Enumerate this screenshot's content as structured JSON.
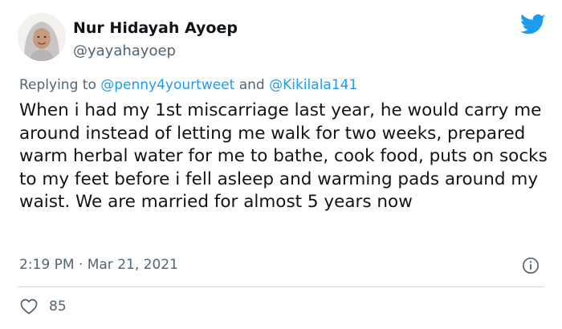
{
  "user": {
    "display_name": "Nur Hidayah Ayoep",
    "handle": "@yayahayoep"
  },
  "reply": {
    "prefix": "Replying to ",
    "mention_1": "@penny4yourtweet",
    "connector": " and ",
    "mention_2": "@Kikilala141"
  },
  "tweet": {
    "text": "When i had my 1st miscarriage last year, he would carry me around instead of letting me walk for two weeks, prepared warm herbal water for me to bathe, cook food, puts on socks to my feet before i fell asleep and warming pads around my waist. We are married for almost 5 years now",
    "timestamp": "2:19 PM · Mar 21, 2021"
  },
  "engagement": {
    "likes": "85"
  },
  "colors": {
    "brand": "#1d9bf0",
    "text": "#0f1419",
    "secondary": "#536471",
    "divider": "#cfd9de"
  },
  "icons": {
    "logo": "twitter-bird-icon",
    "info": "info-icon",
    "like": "heart-icon"
  }
}
